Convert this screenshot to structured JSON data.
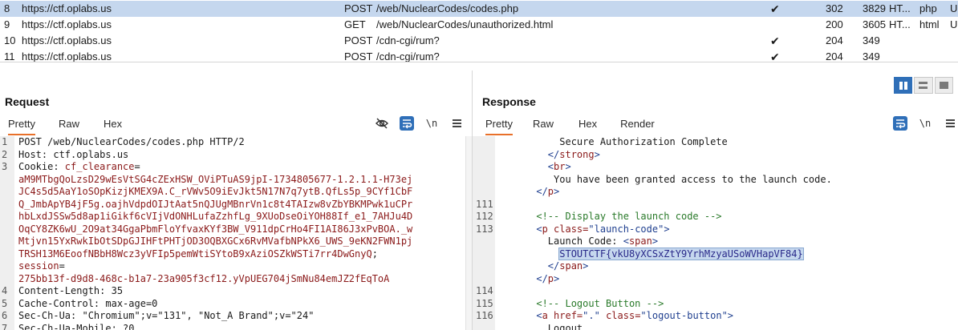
{
  "history": {
    "rows": [
      {
        "num": "8",
        "host": "https://ctf.oplabs.us",
        "method": "POST",
        "url": "/web/NuclearCodes/codes.php",
        "edited": "✔",
        "status": "302",
        "length": "3829",
        "mime": "HT...",
        "ext": "php",
        "extra": "U",
        "selected": true
      },
      {
        "num": "9",
        "host": "https://ctf.oplabs.us",
        "method": "GET",
        "url": "/web/NuclearCodes/unauthorized.html",
        "edited": "",
        "status": "200",
        "length": "3605",
        "mime": "HT...",
        "ext": "html",
        "extra": "U",
        "selected": false
      },
      {
        "num": "10",
        "host": "https://ctf.oplabs.us",
        "method": "POST",
        "url": "/cdn-cgi/rum?",
        "edited": "✔",
        "status": "204",
        "length": "349",
        "mime": "",
        "ext": "",
        "extra": "",
        "selected": false
      },
      {
        "num": "11",
        "host": "https://ctf.oplabs.us",
        "method": "POST",
        "url": "/cdn-cgi/rum?",
        "edited": "✔",
        "status": "204",
        "length": "349",
        "mime": "",
        "ext": "",
        "extra": "",
        "selected": false
      }
    ]
  },
  "request": {
    "title": "Request",
    "tabs": [
      "Pretty",
      "Raw",
      "Hex"
    ],
    "newline_label": "\\n",
    "lines": [
      {
        "n": "1",
        "parts": [
          {
            "t": "POST /web/NuclearCodes/codes.php HTTP/2",
            "c": "k"
          }
        ]
      },
      {
        "n": "2",
        "parts": [
          {
            "t": "Host: ",
            "c": "k"
          },
          {
            "t": "ctf.oplabs.us",
            "c": "k"
          }
        ]
      },
      {
        "n": "3",
        "parts": [
          {
            "t": "Cookie: ",
            "c": "k"
          },
          {
            "t": "cf_clearance",
            "c": "v"
          },
          {
            "t": "=",
            "c": "k"
          }
        ]
      },
      {
        "n": "",
        "parts": [
          {
            "t": "aM9MTbgQoLzsD29wEsVtSG4cZExHSW_OViPTuAS9jpI-1734805677-1.2.1.1-H73ej",
            "c": "v"
          }
        ]
      },
      {
        "n": "",
        "parts": [
          {
            "t": "JC4s5d5AaY1oSOpKizjKMEX9A.C_rVWv5O9iEvJkt5N17N7q7ytB.QfLs5p_9CYf1CbF",
            "c": "v"
          }
        ]
      },
      {
        "n": "",
        "parts": [
          {
            "t": "Q_JmbApYB4jF5g.oajhVdpdOIJtAat5nQJUgMBnrVn1c8t4TAIzw8vZbYBKMPwk1uCPr",
            "c": "v"
          }
        ]
      },
      {
        "n": "",
        "parts": [
          {
            "t": "hbLxdJSSw5d8ap1iGikf6cVIjVdONHLufaZzhfLg_9XUoDseOiYOH88If_e1_7AHJu4D",
            "c": "v"
          }
        ]
      },
      {
        "n": "",
        "parts": [
          {
            "t": "OqCY8ZK6wU_2O9at34GgaPbmFloYfvaxKYf3BW_V911dpCrHo4FI1AI86J3xPvBOA._w",
            "c": "v"
          }
        ]
      },
      {
        "n": "",
        "parts": [
          {
            "t": "Mtjvn15YxRwkIbOtSDpGJIHFtPHTjOD3OQBXGCx6RvMVafbNPkX6_UWS_9eKN2FWN1pj",
            "c": "v"
          }
        ]
      },
      {
        "n": "",
        "parts": [
          {
            "t": "TRSH13M6EoofNBbH8Wcz3yVFIp5pemWtiSYtoB9xAziOSZkWSTi7rr4DwGnyQ",
            "c": "v"
          },
          {
            "t": ";",
            "c": "k"
          }
        ]
      },
      {
        "n": "",
        "parts": [
          {
            "t": "session",
            "c": "v"
          },
          {
            "t": "=",
            "c": "k"
          }
        ]
      },
      {
        "n": "",
        "parts": [
          {
            "t": "275bb13f-d9d8-468c-b1a7-23a905f3cf12.yVpUEG704jSmNu84emJZ2fEqToA",
            "c": "v"
          }
        ]
      },
      {
        "n": "4",
        "parts": [
          {
            "t": "Content-Length: 35",
            "c": "k"
          }
        ]
      },
      {
        "n": "5",
        "parts": [
          {
            "t": "Cache-Control: max-age=0",
            "c": "k"
          }
        ]
      },
      {
        "n": "6",
        "parts": [
          {
            "t": "Sec-Ch-Ua: \"Chromium\";v=\"131\", \"Not_A Brand\";v=\"24\"",
            "c": "k"
          }
        ]
      },
      {
        "n": "7",
        "parts": [
          {
            "t": "Sec-Ch-Ua-Mobile: ?0",
            "c": "k"
          }
        ]
      }
    ]
  },
  "response": {
    "title": "Response",
    "tabs": [
      "Pretty",
      "Raw",
      "Hex",
      "Render"
    ],
    "newline_label": "\\n",
    "lines": [
      {
        "n": "",
        "parts": [
          {
            "t": "          Secure Authorization Complete",
            "c": "plain"
          }
        ]
      },
      {
        "n": "",
        "parts": [
          {
            "t": "        </",
            "c": "tag"
          },
          {
            "t": "strong",
            "c": "an"
          },
          {
            "t": ">",
            "c": "tag"
          }
        ]
      },
      {
        "n": "",
        "parts": [
          {
            "t": "        <",
            "c": "tag"
          },
          {
            "t": "br",
            "c": "an"
          },
          {
            "t": ">",
            "c": "tag"
          }
        ]
      },
      {
        "n": "",
        "parts": [
          {
            "t": "         You have been granted access to the launch code.",
            "c": "plain"
          }
        ]
      },
      {
        "n": "",
        "parts": [
          {
            "t": "      </",
            "c": "tag"
          },
          {
            "t": "p",
            "c": "an"
          },
          {
            "t": ">",
            "c": "tag"
          }
        ]
      },
      {
        "n": "111",
        "parts": []
      },
      {
        "n": "112",
        "parts": [
          {
            "t": "      <!-- Display the launch code -->",
            "c": "cm"
          }
        ]
      },
      {
        "n": "113",
        "parts": [
          {
            "t": "      <",
            "c": "tag"
          },
          {
            "t": "p ",
            "c": "an"
          },
          {
            "t": "class=",
            "c": "an"
          },
          {
            "t": "\"launch-code\"",
            "c": "av"
          },
          {
            "t": ">",
            "c": "tag"
          }
        ]
      },
      {
        "n": "",
        "parts": [
          {
            "t": "        Launch Code: ",
            "c": "plain"
          },
          {
            "t": "<",
            "c": "tag"
          },
          {
            "t": "span",
            "c": "an"
          },
          {
            "t": ">",
            "c": "tag"
          }
        ]
      },
      {
        "n": "",
        "parts": [
          {
            "t": "          ",
            "c": "plain"
          },
          {
            "t": "STOUTCTF{vkU8yXCSxZtY9YrhMzyaUSoWVHapVF84}",
            "c": "hl"
          }
        ]
      },
      {
        "n": "",
        "parts": [
          {
            "t": "        </",
            "c": "tag"
          },
          {
            "t": "span",
            "c": "an"
          },
          {
            "t": ">",
            "c": "tag"
          }
        ]
      },
      {
        "n": "",
        "parts": [
          {
            "t": "      </",
            "c": "tag"
          },
          {
            "t": "p",
            "c": "an"
          },
          {
            "t": ">",
            "c": "tag"
          }
        ]
      },
      {
        "n": "114",
        "parts": []
      },
      {
        "n": "115",
        "parts": [
          {
            "t": "      <!-- Logout Button -->",
            "c": "cm"
          }
        ]
      },
      {
        "n": "116",
        "parts": [
          {
            "t": "      <",
            "c": "tag"
          },
          {
            "t": "a ",
            "c": "an"
          },
          {
            "t": "href=",
            "c": "an"
          },
          {
            "t": "\".\"",
            "c": "av"
          },
          {
            "t": " class=",
            "c": "an"
          },
          {
            "t": "\"logout-button\"",
            "c": "av"
          },
          {
            "t": ">",
            "c": "tag"
          }
        ]
      },
      {
        "n": "",
        "parts": [
          {
            "t": "        Logout",
            "c": "plain"
          }
        ]
      }
    ]
  },
  "colors": {
    "selected_row": "#c5d7ee",
    "accent_tab": "#e8702a",
    "icon_blue": "#2f6fb8"
  },
  "icons": {
    "hide_icon": "eye-slash-icon",
    "wrap_icon": "word-wrap-icon",
    "menu_icon": "hamburger-menu-icon",
    "layout": [
      "split-vertical-icon",
      "split-horizontal-icon",
      "single-pane-icon"
    ]
  }
}
